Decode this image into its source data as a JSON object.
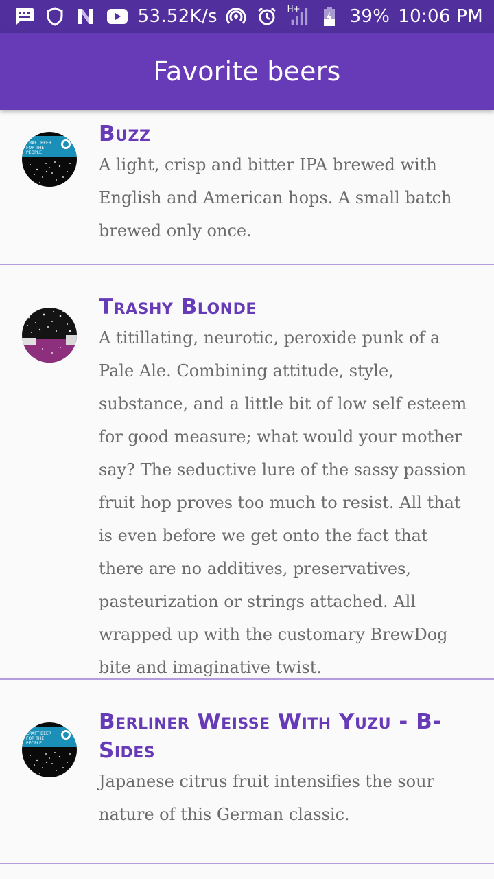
{
  "status_bar": {
    "net_speed": "53.52K/s",
    "battery": "39%",
    "time": "10:06 PM",
    "network_type": "H+",
    "icons": [
      "message-icon",
      "shield-icon",
      "n-app-icon",
      "youtube-icon",
      "hotspot-icon",
      "alarm-icon",
      "signal-icon",
      "battery-icon"
    ]
  },
  "app_bar": {
    "title": "Favorite beers"
  },
  "colors": {
    "status_bar": "#51309d",
    "primary": "#673ab7",
    "divider": "#b39ddb",
    "description_text": "#6b6b6b",
    "background": "#fafafa"
  },
  "beers": [
    {
      "name": "Buzz",
      "description": "A light, crisp and bitter IPA brewed with English and American hops. A small batch brewed only once.",
      "label": "CRAFT BEER FOR THE PEOPLE"
    },
    {
      "name": "Trashy Blonde",
      "description": "A titillating, neurotic, peroxide punk of a Pale Ale. Combining attitude, style, substance, and a little bit of low self esteem for good measure; what would your mother say? The seductive lure of the sassy passion fruit hop proves too much to resist. All that is even before we get onto the fact that there are no additives, preservatives, pasteurization or strings attached. All wrapped up with the customary BrewDog bite and imaginative twist."
    },
    {
      "name": "Berliner Weisse With Yuzu - B-Sides",
      "description": "Japanese citrus fruit intensifies the sour nature of this German classic.",
      "label": "CRAFT BEER FOR THE PEOPLE"
    }
  ]
}
